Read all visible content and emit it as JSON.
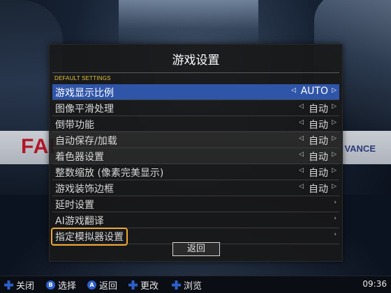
{
  "dialog": {
    "title": "游戏设置",
    "section_label": "DEFAULT SETTINGS",
    "items": [
      {
        "label": "游戏显示比例",
        "value": "AUTO",
        "has_value": true
      },
      {
        "label": "图像平滑处理",
        "value": "自动",
        "has_value": true
      },
      {
        "label": "倒带功能",
        "value": "自动",
        "has_value": true
      },
      {
        "label": "自动保存/加载",
        "value": "自动",
        "has_value": true
      },
      {
        "label": "着色器设置",
        "value": "自动",
        "has_value": true
      },
      {
        "label": "整数缩放 (像素完美显示)",
        "value": "自动",
        "has_value": true
      },
      {
        "label": "游戏装饰边框",
        "value": "自动",
        "has_value": true
      },
      {
        "label": "延时设置",
        "value": "",
        "has_value": false
      },
      {
        "label": "AI游戏翻译",
        "value": "",
        "has_value": false
      },
      {
        "label": "指定模拟器设置",
        "value": "",
        "has_value": false
      }
    ],
    "selected_index": 0,
    "focused_index": 9,
    "back_label": "返回"
  },
  "background": {
    "banner_left": "FAI",
    "banner_right": "VANCE"
  },
  "bottombar": {
    "hints": [
      {
        "icon": "B",
        "label": "关闭",
        "icon_name": "dpad-icon"
      },
      {
        "icon": "B",
        "label": "选择",
        "icon_name": "button-b-icon"
      },
      {
        "icon": "A",
        "label": "返回",
        "icon_name": "button-a-icon"
      },
      {
        "icon": "",
        "label": "更改",
        "icon_name": "dpad-icon"
      },
      {
        "icon": "",
        "label": "浏览",
        "icon_name": "dpad-icon"
      }
    ],
    "clock": "09:36"
  },
  "colors": {
    "selected_bg": "#2f55a8",
    "focus_outline": "#f0a830",
    "section_label": "#e6c23a",
    "hint_button": "#2c5fc9"
  }
}
